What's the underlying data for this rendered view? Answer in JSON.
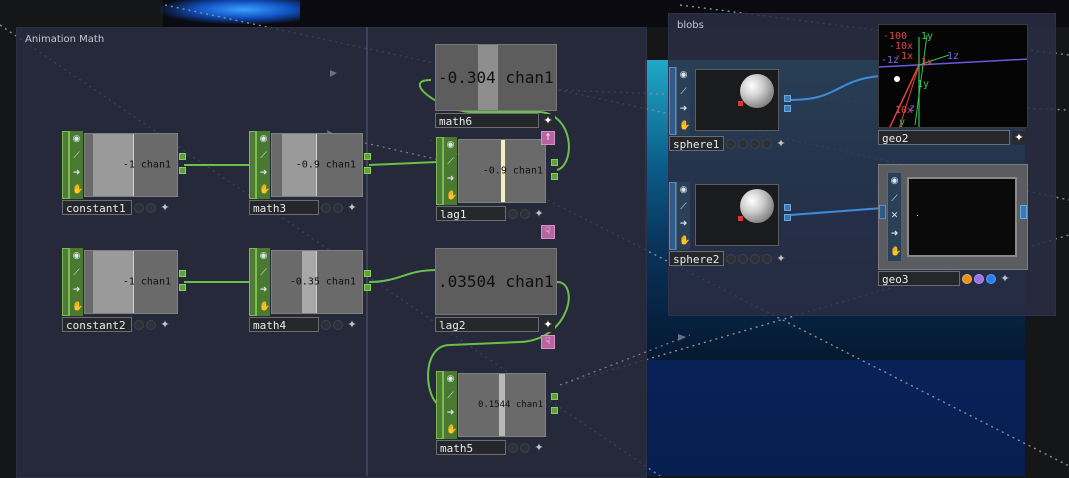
{
  "panels": {
    "animation_math": {
      "title": "Animation Math"
    },
    "blobs": {
      "title": "blobs"
    }
  },
  "colors": {
    "chop_green": "#4f7a38",
    "sop_blue": "#2f5a8a",
    "wire_green": "#6ac04c",
    "wire_blue": "#3a8ee0",
    "flag_orange": "#e8901c",
    "flag_purple": "#9b6fe8",
    "flag_blue": "#2a7ee8"
  },
  "nodes": {
    "constant1": {
      "name": "constant1",
      "value": "-1 chan1"
    },
    "constant2": {
      "name": "constant2",
      "value": "-1 chan1"
    },
    "math3": {
      "name": "math3",
      "value": "-0.9 chan1"
    },
    "math4": {
      "name": "math4",
      "value": "-0.35 chan1"
    },
    "lag1": {
      "name": "lag1",
      "value": "-0.9 chan1"
    },
    "lag2": {
      "name": "lag2",
      "value": ".03504 chan1"
    },
    "math5": {
      "name": "math5",
      "value": "0.1544 chan1"
    },
    "math6": {
      "name": "math6",
      "value": "-0.304 chan1"
    },
    "sphere1": {
      "name": "sphere1"
    },
    "sphere2": {
      "name": "sphere2"
    },
    "geo2": {
      "name": "geo2"
    },
    "geo3": {
      "name": "geo3"
    }
  },
  "gizmo": {
    "labels": [
      "-100",
      "-10x",
      "-1x",
      "1y",
      "1z",
      "1x",
      "-1z",
      "1y",
      "10x",
      "z",
      "y"
    ]
  },
  "icons": [
    "info-icon",
    "graph-icon",
    "arrow-right-icon",
    "hand-icon",
    "star-icon",
    "cross-icon",
    "hand-pointer-icon"
  ]
}
